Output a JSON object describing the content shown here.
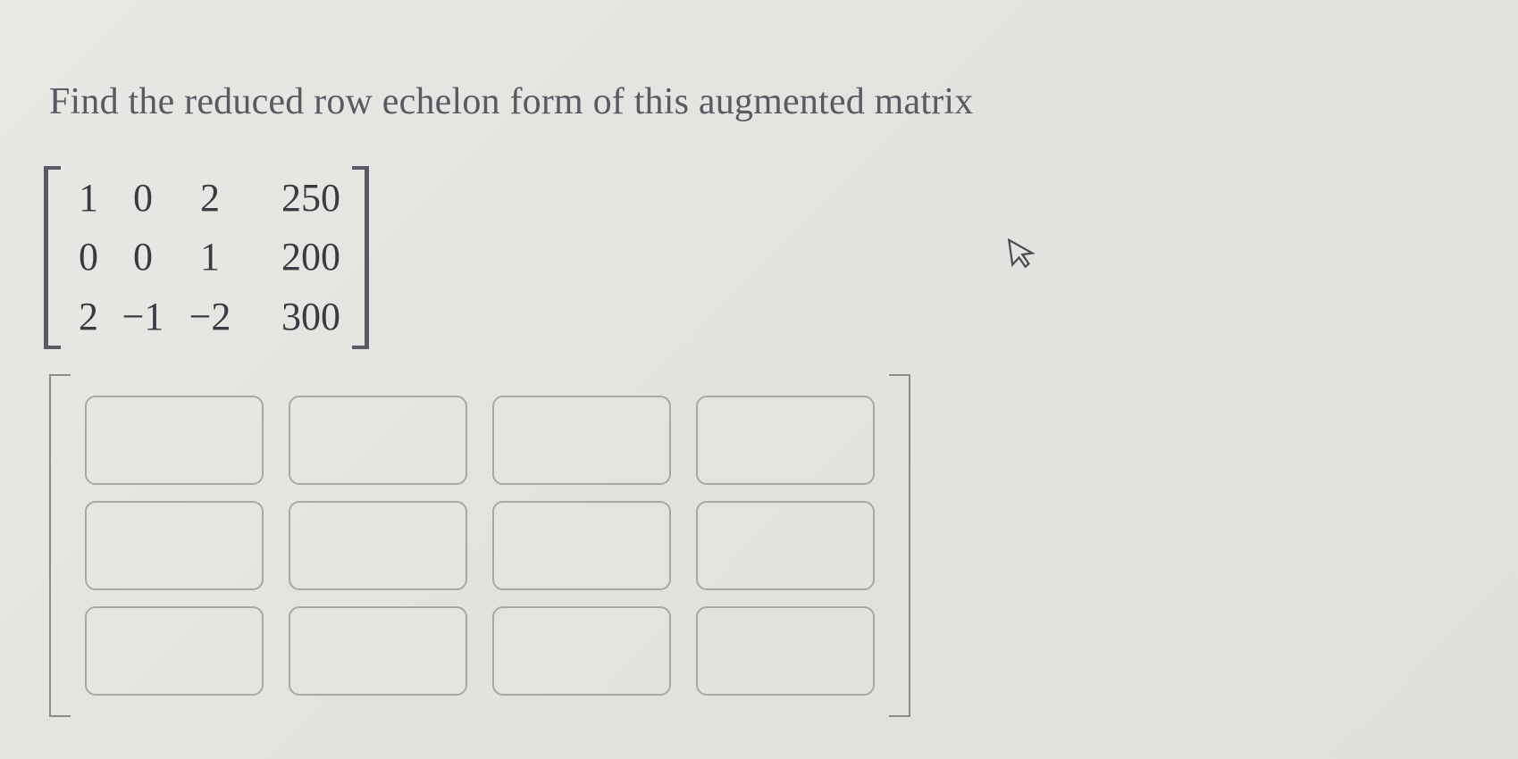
{
  "prompt": "Find the reduced row echelon form of this augmented matrix",
  "given_matrix": {
    "rows": [
      [
        "1",
        "0",
        "2",
        "250"
      ],
      [
        "0",
        "0",
        "1",
        "200"
      ],
      [
        "2",
        "−1",
        "−2",
        "300"
      ]
    ]
  },
  "answer_matrix": {
    "rows": 3,
    "cols": 4,
    "values": [
      [
        "",
        "",
        "",
        ""
      ],
      [
        "",
        "",
        "",
        ""
      ],
      [
        "",
        "",
        "",
        ""
      ]
    ]
  }
}
